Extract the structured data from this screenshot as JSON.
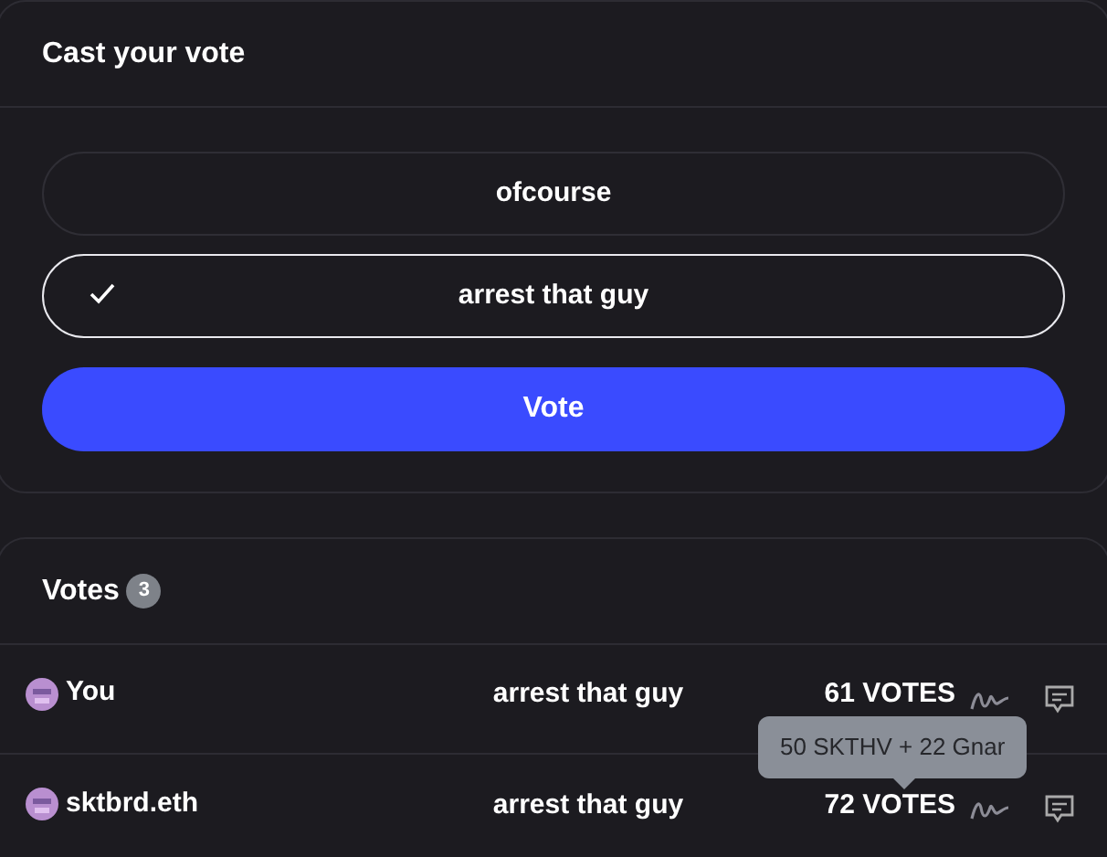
{
  "vote_panel": {
    "title": "Cast your vote",
    "choices": [
      {
        "label": "ofcourse",
        "selected": false
      },
      {
        "label": "arrest that guy",
        "selected": true
      }
    ],
    "button": "Vote"
  },
  "votes": {
    "title": "Votes",
    "count": "3",
    "rows": [
      {
        "voter": "You",
        "choice": "arrest that guy",
        "power": "61 VOTES"
      },
      {
        "voter": "sktbrd.eth",
        "choice": "arrest that guy",
        "power": "72 VOTES"
      }
    ],
    "tooltip": "50 SKTHV + 22 Gnar"
  }
}
